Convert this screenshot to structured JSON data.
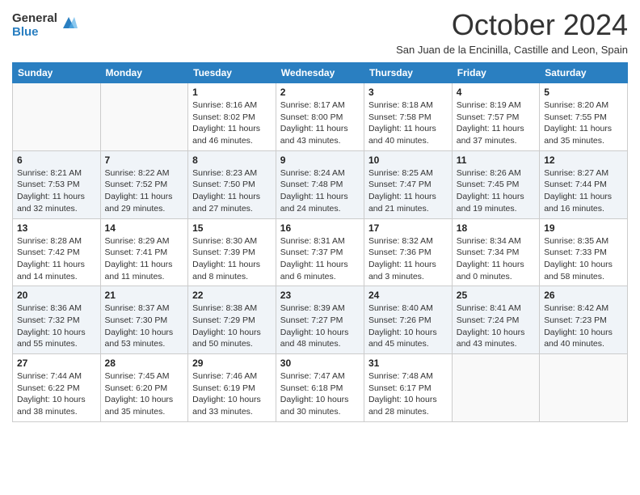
{
  "header": {
    "logo_general": "General",
    "logo_blue": "Blue",
    "title": "October 2024",
    "subtitle": "San Juan de la Encinilla, Castille and Leon, Spain"
  },
  "weekdays": [
    "Sunday",
    "Monday",
    "Tuesday",
    "Wednesday",
    "Thursday",
    "Friday",
    "Saturday"
  ],
  "weeks": [
    [
      {
        "day": "",
        "info": ""
      },
      {
        "day": "",
        "info": ""
      },
      {
        "day": "1",
        "info": "Sunrise: 8:16 AM\nSunset: 8:02 PM\nDaylight: 11 hours and 46 minutes."
      },
      {
        "day": "2",
        "info": "Sunrise: 8:17 AM\nSunset: 8:00 PM\nDaylight: 11 hours and 43 minutes."
      },
      {
        "day": "3",
        "info": "Sunrise: 8:18 AM\nSunset: 7:58 PM\nDaylight: 11 hours and 40 minutes."
      },
      {
        "day": "4",
        "info": "Sunrise: 8:19 AM\nSunset: 7:57 PM\nDaylight: 11 hours and 37 minutes."
      },
      {
        "day": "5",
        "info": "Sunrise: 8:20 AM\nSunset: 7:55 PM\nDaylight: 11 hours and 35 minutes."
      }
    ],
    [
      {
        "day": "6",
        "info": "Sunrise: 8:21 AM\nSunset: 7:53 PM\nDaylight: 11 hours and 32 minutes."
      },
      {
        "day": "7",
        "info": "Sunrise: 8:22 AM\nSunset: 7:52 PM\nDaylight: 11 hours and 29 minutes."
      },
      {
        "day": "8",
        "info": "Sunrise: 8:23 AM\nSunset: 7:50 PM\nDaylight: 11 hours and 27 minutes."
      },
      {
        "day": "9",
        "info": "Sunrise: 8:24 AM\nSunset: 7:48 PM\nDaylight: 11 hours and 24 minutes."
      },
      {
        "day": "10",
        "info": "Sunrise: 8:25 AM\nSunset: 7:47 PM\nDaylight: 11 hours and 21 minutes."
      },
      {
        "day": "11",
        "info": "Sunrise: 8:26 AM\nSunset: 7:45 PM\nDaylight: 11 hours and 19 minutes."
      },
      {
        "day": "12",
        "info": "Sunrise: 8:27 AM\nSunset: 7:44 PM\nDaylight: 11 hours and 16 minutes."
      }
    ],
    [
      {
        "day": "13",
        "info": "Sunrise: 8:28 AM\nSunset: 7:42 PM\nDaylight: 11 hours and 14 minutes."
      },
      {
        "day": "14",
        "info": "Sunrise: 8:29 AM\nSunset: 7:41 PM\nDaylight: 11 hours and 11 minutes."
      },
      {
        "day": "15",
        "info": "Sunrise: 8:30 AM\nSunset: 7:39 PM\nDaylight: 11 hours and 8 minutes."
      },
      {
        "day": "16",
        "info": "Sunrise: 8:31 AM\nSunset: 7:37 PM\nDaylight: 11 hours and 6 minutes."
      },
      {
        "day": "17",
        "info": "Sunrise: 8:32 AM\nSunset: 7:36 PM\nDaylight: 11 hours and 3 minutes."
      },
      {
        "day": "18",
        "info": "Sunrise: 8:34 AM\nSunset: 7:34 PM\nDaylight: 11 hours and 0 minutes."
      },
      {
        "day": "19",
        "info": "Sunrise: 8:35 AM\nSunset: 7:33 PM\nDaylight: 10 hours and 58 minutes."
      }
    ],
    [
      {
        "day": "20",
        "info": "Sunrise: 8:36 AM\nSunset: 7:32 PM\nDaylight: 10 hours and 55 minutes."
      },
      {
        "day": "21",
        "info": "Sunrise: 8:37 AM\nSunset: 7:30 PM\nDaylight: 10 hours and 53 minutes."
      },
      {
        "day": "22",
        "info": "Sunrise: 8:38 AM\nSunset: 7:29 PM\nDaylight: 10 hours and 50 minutes."
      },
      {
        "day": "23",
        "info": "Sunrise: 8:39 AM\nSunset: 7:27 PM\nDaylight: 10 hours and 48 minutes."
      },
      {
        "day": "24",
        "info": "Sunrise: 8:40 AM\nSunset: 7:26 PM\nDaylight: 10 hours and 45 minutes."
      },
      {
        "day": "25",
        "info": "Sunrise: 8:41 AM\nSunset: 7:24 PM\nDaylight: 10 hours and 43 minutes."
      },
      {
        "day": "26",
        "info": "Sunrise: 8:42 AM\nSunset: 7:23 PM\nDaylight: 10 hours and 40 minutes."
      }
    ],
    [
      {
        "day": "27",
        "info": "Sunrise: 7:44 AM\nSunset: 6:22 PM\nDaylight: 10 hours and 38 minutes."
      },
      {
        "day": "28",
        "info": "Sunrise: 7:45 AM\nSunset: 6:20 PM\nDaylight: 10 hours and 35 minutes."
      },
      {
        "day": "29",
        "info": "Sunrise: 7:46 AM\nSunset: 6:19 PM\nDaylight: 10 hours and 33 minutes."
      },
      {
        "day": "30",
        "info": "Sunrise: 7:47 AM\nSunset: 6:18 PM\nDaylight: 10 hours and 30 minutes."
      },
      {
        "day": "31",
        "info": "Sunrise: 7:48 AM\nSunset: 6:17 PM\nDaylight: 10 hours and 28 minutes."
      },
      {
        "day": "",
        "info": ""
      },
      {
        "day": "",
        "info": ""
      }
    ]
  ]
}
